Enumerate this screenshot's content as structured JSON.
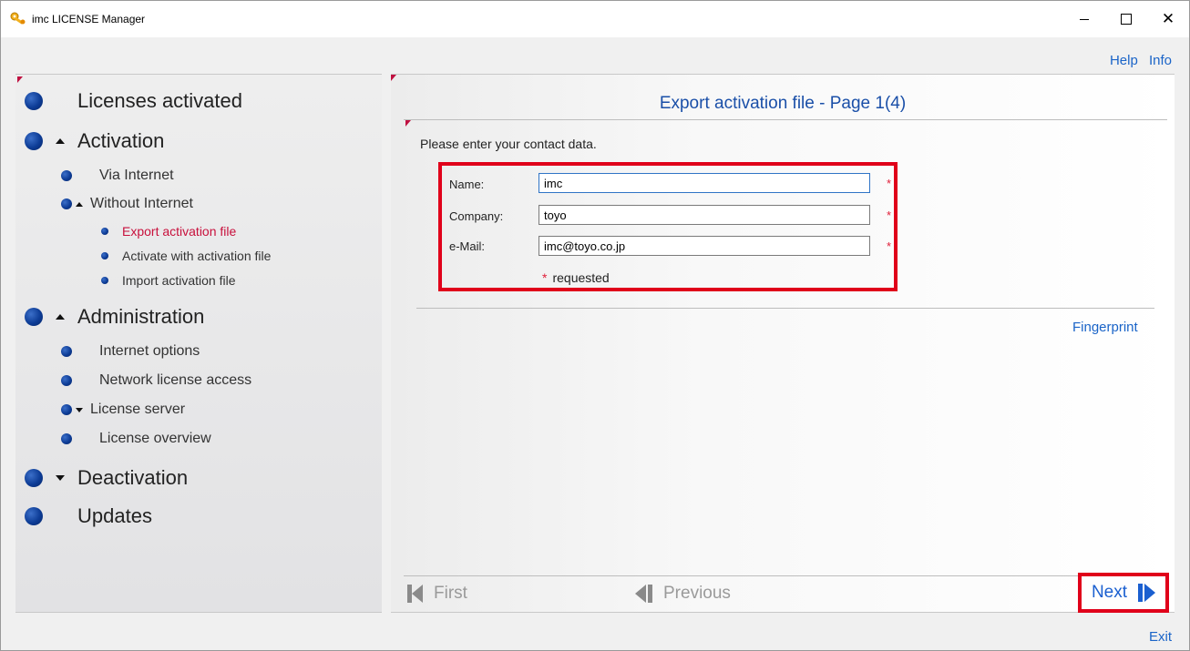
{
  "window": {
    "title": "imc LICENSE Manager",
    "controls": {
      "minimize": "minimize",
      "maximize": "maximize",
      "close": "close"
    }
  },
  "toplinks": {
    "help": "Help",
    "info": "Info"
  },
  "nav": {
    "licenses_activated": "Licenses activated",
    "activation": "Activation",
    "via_internet": "Via Internet",
    "without_internet": "Without Internet",
    "export_activation_file": "Export activation file",
    "activate_with_activation_file": "Activate with activation file",
    "import_activation_file": "Import activation file",
    "administration": "Administration",
    "internet_options": "Internet options",
    "network_license_access": "Network license access",
    "license_server": "License server",
    "license_overview": "License overview",
    "deactivation": "Deactivation",
    "updates": "Updates"
  },
  "content": {
    "page_title": "Export activation file - Page 1(4)",
    "intro": "Please enter your contact data.",
    "form": {
      "name_label": "Name:",
      "name_value": "imc",
      "company_label": "Company:",
      "company_value": "toyo",
      "email_label": "e-Mail:",
      "email_value": "imc@toyo.co.jp",
      "required_mark": "*",
      "required_note": "requested"
    },
    "fingerprint": "Fingerprint"
  },
  "footer": {
    "first": "First",
    "previous": "Previous",
    "next": "Next",
    "exit": "Exit"
  },
  "colors": {
    "accent_blue": "#1a64c8",
    "active_red": "#c8103c",
    "highlight_red": "#e0001a",
    "nav_dot_blue": "#0d3c96"
  }
}
